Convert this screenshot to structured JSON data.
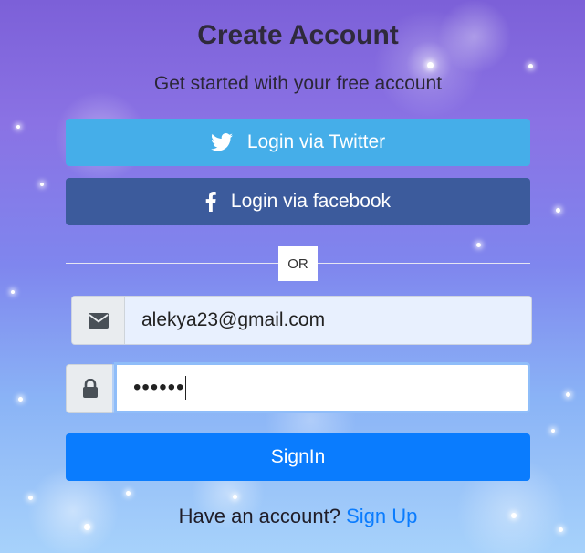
{
  "header": {
    "title": "Create Account",
    "subtitle": "Get started with your free account"
  },
  "social": {
    "twitter_label": "Login via Twitter",
    "facebook_label": "Login via facebook",
    "twitter_icon": "twitter-icon",
    "facebook_icon": "facebook-icon"
  },
  "divider": {
    "label": "OR"
  },
  "form": {
    "email_value": "alekya23@gmail.com",
    "email_icon": "envelope-icon",
    "password_masked": "••••••",
    "password_icon": "lock-icon",
    "submit_label": "SignIn"
  },
  "footer": {
    "prompt": "Have an account?",
    "link_label": "Sign Up"
  },
  "colors": {
    "twitter": "#45aee9",
    "facebook": "#3c5b9c",
    "primary": "#0a7cfe"
  }
}
